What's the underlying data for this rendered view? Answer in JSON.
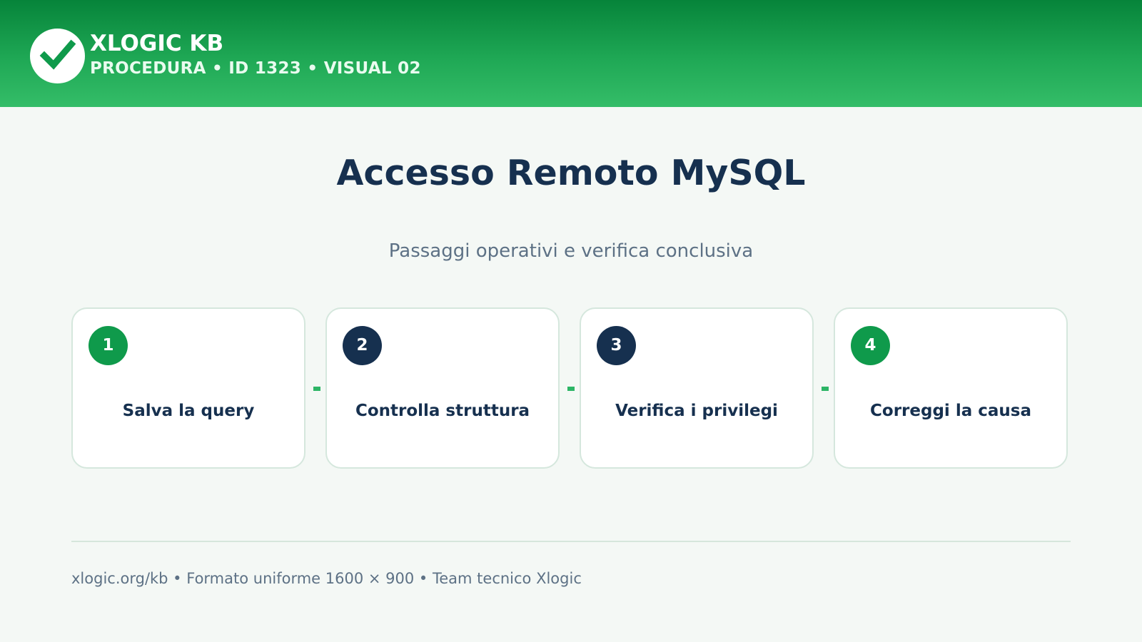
{
  "header": {
    "logo_icon": "check-icon",
    "brand": "XLOGIC KB",
    "subtitle": "PROCEDURA • ID 1323 • VISUAL 02"
  },
  "main": {
    "title": "Accesso Remoto MySQL",
    "subtitle": "Passaggi operativi e verifica conclusiva"
  },
  "steps": [
    {
      "number": "1",
      "label": "Salva la query"
    },
    {
      "number": "2",
      "label": "Controlla struttura"
    },
    {
      "number": "3",
      "label": "Verifica i privilegi"
    },
    {
      "number": "4",
      "label": "Correggi la causa"
    }
  ],
  "footer": {
    "text": "xlogic.org/kb • Formato uniforme 1600 × 900 • Team tecnico Xlogic"
  },
  "colors": {
    "header_green": "#06843a",
    "accent_green": "#0f9a4b",
    "navy": "#16304f",
    "background": "#f4f8f5"
  }
}
